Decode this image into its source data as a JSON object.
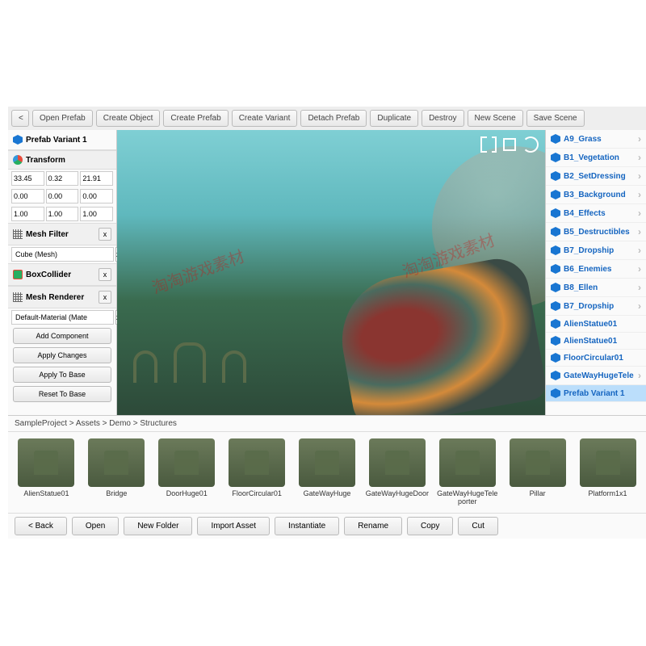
{
  "toolbar": {
    "back": "<",
    "buttons": [
      "Open Prefab",
      "Create Object",
      "Create Prefab",
      "Create Variant",
      "Detach Prefab",
      "Duplicate",
      "Destroy",
      "New Scene",
      "Save Scene"
    ]
  },
  "inspector": {
    "title": "Prefab Variant 1",
    "components": {
      "transform": {
        "label": "Transform",
        "row1": [
          "33.45",
          "0.32",
          "21.91"
        ],
        "row2": [
          "0.00",
          "0.00",
          "0.00"
        ],
        "row3": [
          "1.00",
          "1.00",
          "1.00"
        ]
      },
      "meshFilter": {
        "label": "Mesh Filter",
        "value": "Cube (Mesh)",
        "x": "x"
      },
      "boxCollider": {
        "label": "BoxCollider",
        "x": "x"
      },
      "meshRenderer": {
        "label": "Mesh Renderer",
        "value": "Default-Material (Mate",
        "x": "x"
      }
    },
    "actions": [
      "Add Component",
      "Apply Changes",
      "Apply To Base",
      "Reset To Base"
    ]
  },
  "hierarchy": [
    {
      "name": "A9_Grass",
      "expandable": true
    },
    {
      "name": "B1_Vegetation",
      "expandable": true
    },
    {
      "name": "B2_SetDressing",
      "expandable": true
    },
    {
      "name": "B3_Background",
      "expandable": true
    },
    {
      "name": "B4_Effects",
      "expandable": true
    },
    {
      "name": "B5_Destructibles",
      "expandable": true
    },
    {
      "name": "B7_Dropship",
      "expandable": true
    },
    {
      "name": "B6_Enemies",
      "expandable": true
    },
    {
      "name": "B8_Ellen",
      "expandable": true
    },
    {
      "name": "B7_Dropship",
      "expandable": true
    },
    {
      "name": "AlienStatue01",
      "expandable": false
    },
    {
      "name": "AlienStatue01",
      "expandable": false
    },
    {
      "name": "FloorCircular01",
      "expandable": false
    },
    {
      "name": "GateWayHugeTele",
      "expandable": true
    },
    {
      "name": "Prefab Variant 1",
      "expandable": false,
      "selected": true
    }
  ],
  "breadcrumb": "SampleProject > Assets > Demo > Structures",
  "assets": [
    "AlienStatue01",
    "Bridge",
    "DoorHuge01",
    "FloorCircular01",
    "GateWayHuge",
    "GateWayHugeDoor",
    "GateWayHugeTeleporter",
    "Pillar",
    "Platform1x1"
  ],
  "bottomToolbar": [
    "< Back",
    "Open",
    "New Folder",
    "Import Asset",
    "Instantiate",
    "Rename",
    "Copy",
    "Cut"
  ],
  "watermark": "淘淘游戏素材"
}
